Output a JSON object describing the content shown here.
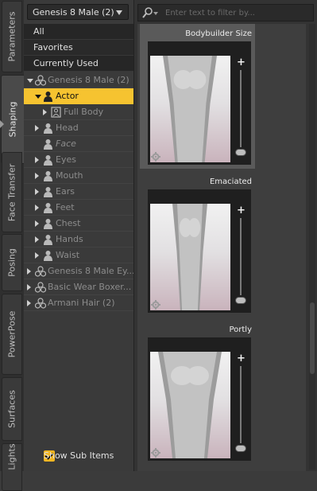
{
  "tabs": [
    {
      "label": "Parameters",
      "active": false
    },
    {
      "label": "Shaping",
      "active": true
    },
    {
      "label": "Face Transfer",
      "active": false
    },
    {
      "label": "Posing",
      "active": false
    },
    {
      "label": "PowerPose",
      "active": false
    },
    {
      "label": "Surfaces",
      "active": false
    },
    {
      "label": "Lights",
      "active": false
    }
  ],
  "left": {
    "dropdown": "Genesis 8 Male (2)",
    "categories": [
      "All",
      "Favorites",
      "Currently Used"
    ],
    "tree": [
      {
        "label": "Genesis 8 Male (2)",
        "expander": "down",
        "icon": "figure-node-icon",
        "italic": false,
        "selected": false
      },
      {
        "label": "Actor",
        "expander": "down",
        "icon": "person-icon",
        "italic": false,
        "selected": true
      },
      {
        "label": "Full Body",
        "expander": "right",
        "icon": "fullbody-icon",
        "italic": false,
        "selected": false
      },
      {
        "label": "Head",
        "expander": "right",
        "icon": "person-icon",
        "italic": false,
        "selected": false
      },
      {
        "label": "Face",
        "expander": "none",
        "icon": "person-icon",
        "italic": true,
        "selected": false
      },
      {
        "label": "Eyes",
        "expander": "right",
        "icon": "person-icon",
        "italic": false,
        "selected": false
      },
      {
        "label": "Mouth",
        "expander": "right",
        "icon": "person-icon",
        "italic": false,
        "selected": false
      },
      {
        "label": "Ears",
        "expander": "right",
        "icon": "person-icon",
        "italic": false,
        "selected": false
      },
      {
        "label": "Feet",
        "expander": "right",
        "icon": "person-icon",
        "italic": false,
        "selected": false
      },
      {
        "label": "Chest",
        "expander": "right",
        "icon": "person-icon",
        "italic": false,
        "selected": false
      },
      {
        "label": "Hands",
        "expander": "right",
        "icon": "person-icon",
        "italic": false,
        "selected": false
      },
      {
        "label": "Waist",
        "expander": "right",
        "icon": "person-icon",
        "italic": false,
        "selected": false
      },
      {
        "label": "Genesis 8 Male Ey...",
        "expander": "right",
        "icon": "figure-node-icon",
        "italic": false,
        "selected": false
      },
      {
        "label": "Basic Wear Boxer...",
        "expander": "right",
        "icon": "figure-node-icon",
        "italic": false,
        "selected": false
      },
      {
        "label": "Armani Hair (2)",
        "expander": "right",
        "icon": "figure-node-icon",
        "italic": false,
        "selected": false
      }
    ],
    "show_sub_items": {
      "label": "Show Sub Items",
      "checked": true
    }
  },
  "right": {
    "filter_placeholder": "Enter text to filter by...",
    "presets": [
      {
        "title": "Bodybuilder Size",
        "selected": true
      },
      {
        "title": "Emaciated",
        "selected": false
      },
      {
        "title": "Portly",
        "selected": false
      }
    ]
  }
}
